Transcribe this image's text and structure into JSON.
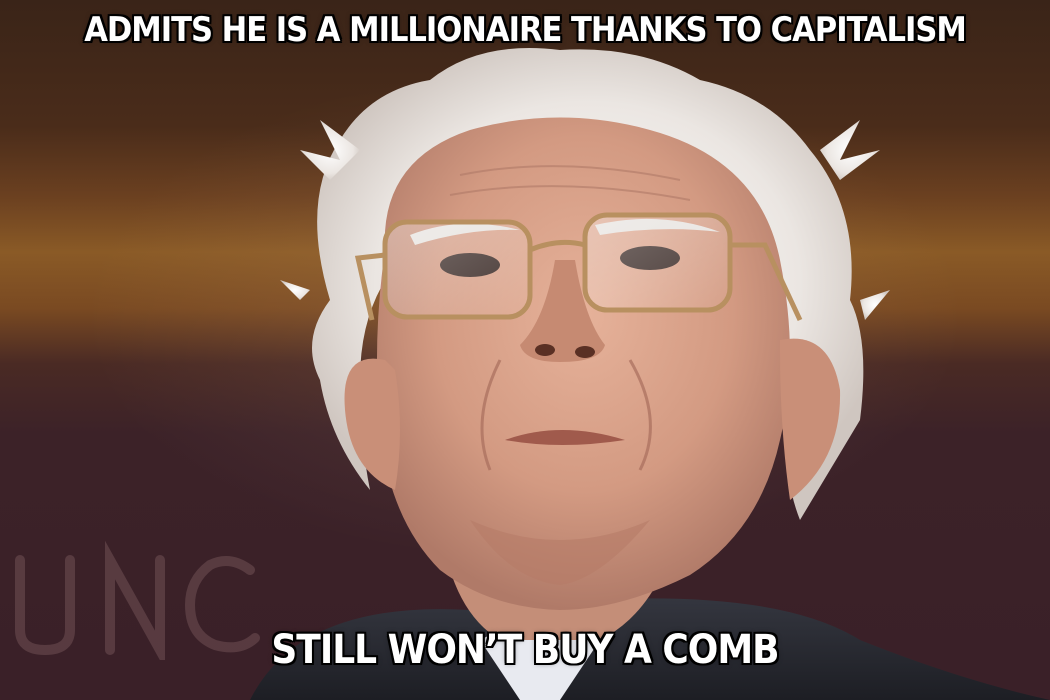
{
  "meme": {
    "top_caption": "ADMITS HE IS A MILLIONAIRE THANKS TO CAPITALISM",
    "bottom_caption": "STILL WON’T BUY A COMB"
  },
  "colors": {
    "caption_fill": "#ffffff",
    "caption_outline": "#000000",
    "hair": "#eeeae6",
    "skin": "#d8a088",
    "backdrop_band": "#8a5a26",
    "backdrop_lower": "#3c2228",
    "suit": "#2a2c34"
  }
}
